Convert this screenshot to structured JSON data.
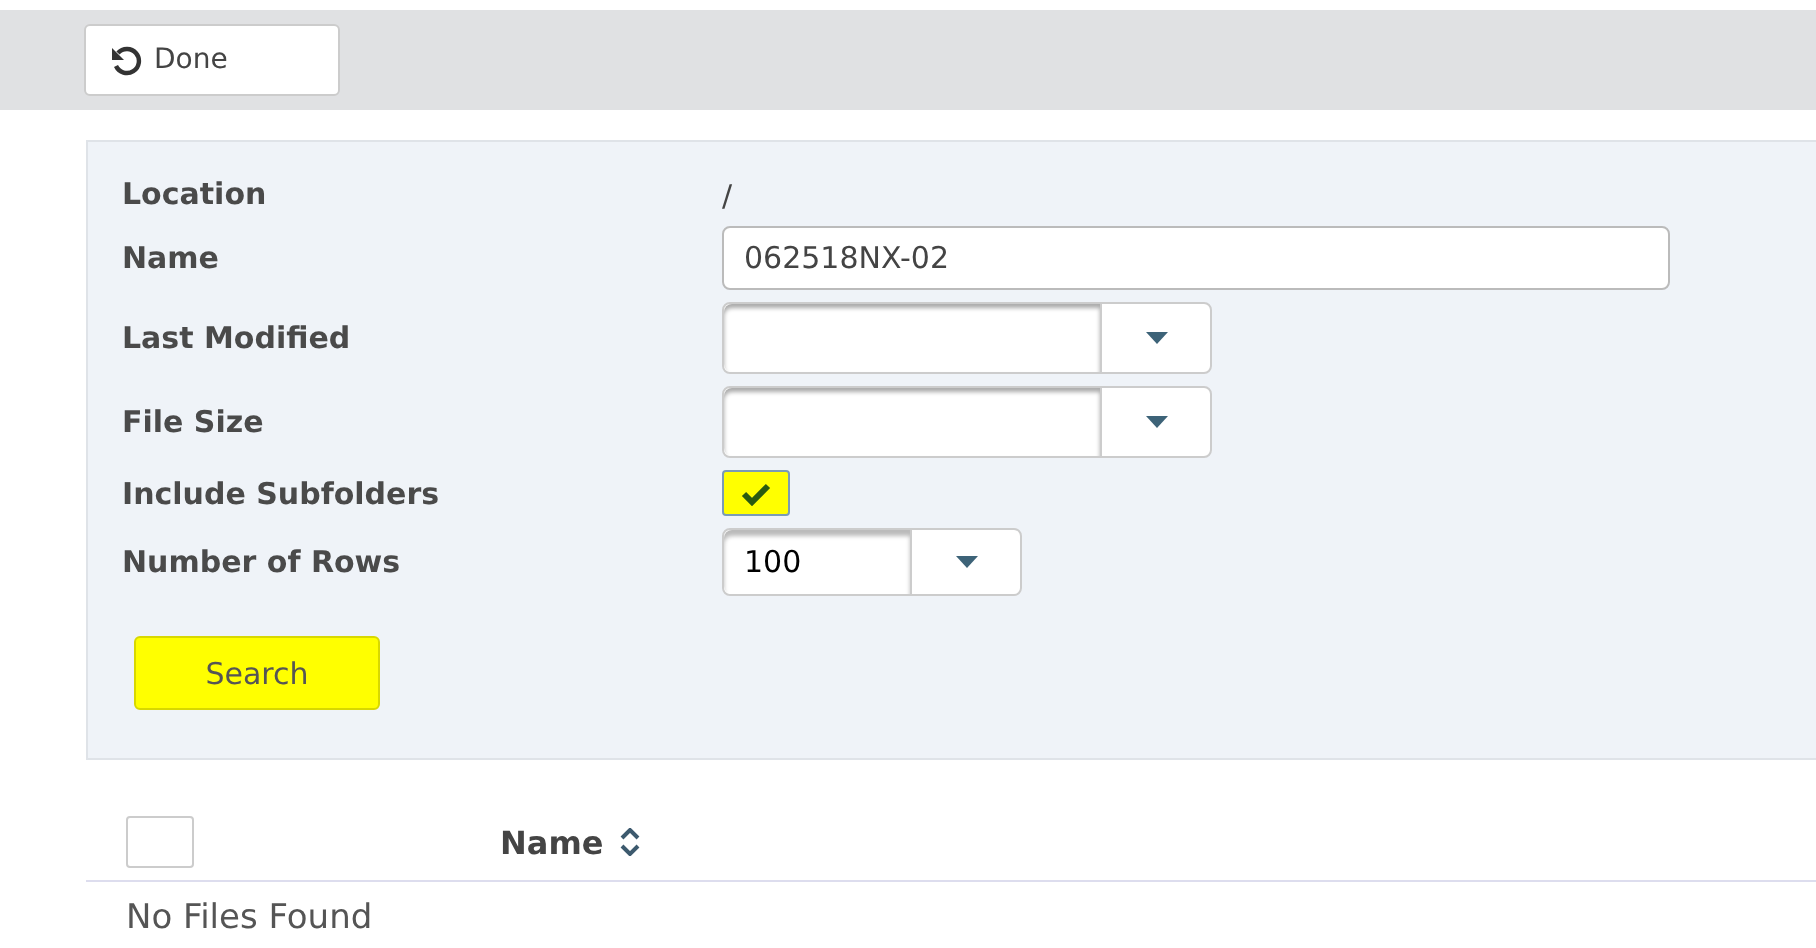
{
  "toolbar": {
    "done_button": "Done"
  },
  "form": {
    "fields": [
      {
        "kind": "text",
        "label": "Location",
        "value": "/"
      },
      {
        "kind": "input",
        "label": "Name",
        "value": "062518NX-02"
      },
      {
        "kind": "dropdown",
        "label": "Last Modified"
      },
      {
        "kind": "dropdown",
        "label": "File Size"
      },
      {
        "kind": "checkbox",
        "label": "Include Subfolders",
        "checked": true
      },
      {
        "kind": "select",
        "label": "Number of Rows",
        "value": "100"
      }
    ],
    "search_button": "Search"
  },
  "table": {
    "select_all_checked": false,
    "columns": [
      {
        "label": "Name",
        "sortable": true
      }
    ],
    "empty_message": "No Files Found"
  }
}
